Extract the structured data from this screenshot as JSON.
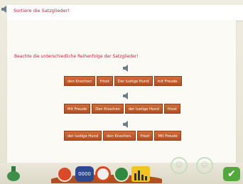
{
  "header": {
    "title": "Sortiere die Satzglieder!"
  },
  "instruction": "Beachte die unterschiedliche Reihenfolge der Satzglieder!",
  "rows": [
    {
      "tiles": [
        "den Knochen",
        "frisst",
        "Der lustige Hund",
        "mit Freude."
      ]
    },
    {
      "tiles": [
        "Mit Freude",
        "Den Knochen",
        "der lustige Hund",
        "frisst"
      ]
    },
    {
      "tiles": [
        "der lustige Hund",
        "den Knochen.",
        "frisst",
        "Mit Freude"
      ]
    }
  ],
  "toolbar": {
    "tools": [
      "red-diamond-icon",
      "counter-icon",
      "gauge-icon",
      "green-cube-icon",
      "bars-chart-icon"
    ],
    "counter_display": "0000"
  },
  "colors": {
    "accent_red": "#c21f3b",
    "tile_orange": "#c45d2c",
    "check_green": "#53a83d"
  }
}
